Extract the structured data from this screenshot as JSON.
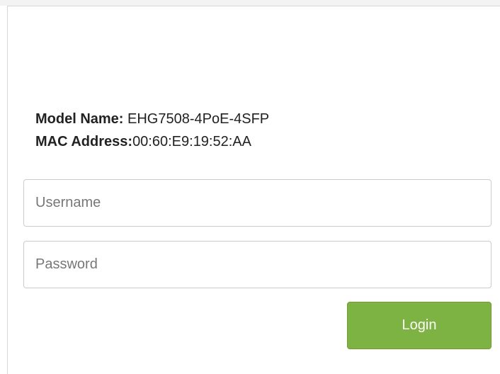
{
  "device_info": {
    "model_label": "Model Name:",
    "model_value": " EHG7508-4PoE-4SFP",
    "mac_label": "MAC Address:",
    "mac_value": "00:60:E9:19:52:AA"
  },
  "login_form": {
    "username": {
      "placeholder": "Username",
      "value": ""
    },
    "password": {
      "placeholder": "Password",
      "value": ""
    },
    "login_label": "Login"
  },
  "colors": {
    "login_button": "#7cb342",
    "border": "#cccccc",
    "text": "#222222",
    "placeholder": "#777777"
  }
}
